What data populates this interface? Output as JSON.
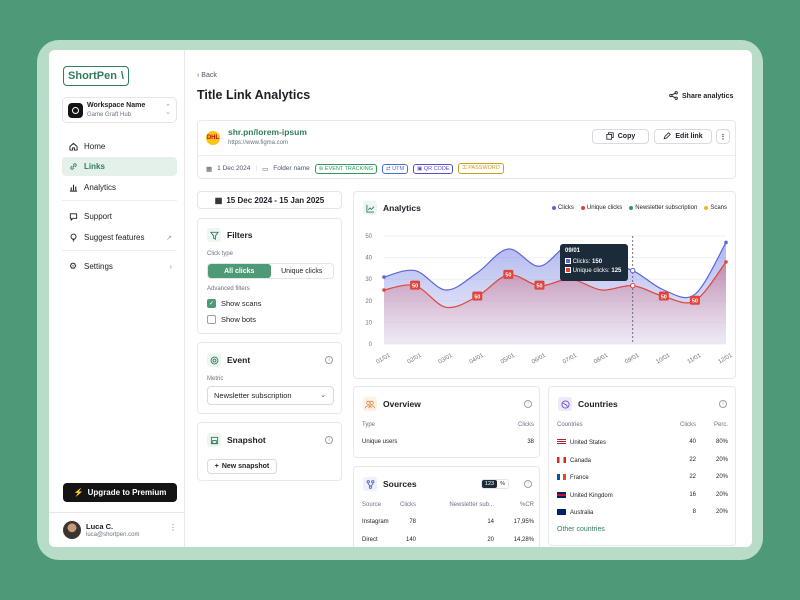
{
  "sidebar": {
    "logo": "ShortPen",
    "workspace": {
      "name": "Workspace Name",
      "sub": "Game Graft Hub"
    },
    "nav": [
      {
        "label": "Home",
        "icon": "home-icon"
      },
      {
        "label": "Links",
        "icon": "link-icon",
        "active": true
      },
      {
        "label": "Analytics",
        "icon": "bar-chart-icon"
      }
    ],
    "nav2": [
      {
        "label": "Support",
        "icon": "chat-icon"
      },
      {
        "label": "Suggest features",
        "icon": "lightbulb-icon"
      }
    ],
    "settings": "Settings",
    "upgrade": "Upgrade to Premium",
    "user": {
      "name": "Luca C.",
      "email": "luca@shortpen.com"
    }
  },
  "header": {
    "back": "Back",
    "title": "Title Link Analytics",
    "share": "Share analytics"
  },
  "link": {
    "short": "shr.pn/lorem-ipsum",
    "dest": "https://www.figma.com",
    "copy": "Copy",
    "edit": "Edit link",
    "date": "1 Dec 2024",
    "folder": "Folder name",
    "tags": [
      {
        "label": "EVENT TRACKING",
        "color": "#2f9a5c"
      },
      {
        "label": "UTM",
        "color": "#4a6fd1"
      },
      {
        "label": "QR CODE",
        "color": "#5a4fc9"
      },
      {
        "label": "PASSWORD",
        "color": "#c9a020"
      }
    ]
  },
  "daterange": "15 Dec 2024 - 15 Jan 2025",
  "filters": {
    "title": "Filters",
    "click_type_label": "Click type",
    "all": "All clicks",
    "unique": "Unique clicks",
    "advanced_label": "Advanced filters",
    "show_scans": "Show scans",
    "show_scans_checked": true,
    "show_bots": "Show bots",
    "show_bots_checked": false
  },
  "event": {
    "title": "Event",
    "metric_label": "Metric",
    "metric_value": "Newsletter subscription"
  },
  "snapshot": {
    "title": "Snapshot",
    "button": "New snapshot"
  },
  "analytics": {
    "title": "Analytics",
    "legend": [
      {
        "label": "Clicks",
        "color": "#5b66d9"
      },
      {
        "label": "Unique clicks",
        "color": "#e0443a"
      },
      {
        "label": "Newsletter subscription",
        "color": "#2f9a5c"
      },
      {
        "label": "Scans",
        "color": "#f0b429"
      }
    ],
    "tooltip": {
      "date": "09/01",
      "clicks_label": "Clicks:",
      "clicks": "150",
      "unique_label": "Unique clicks:",
      "unique": "125"
    }
  },
  "chart_data": {
    "type": "area",
    "x": [
      "01/01",
      "02/01",
      "03/01",
      "04/01",
      "05/01",
      "06/01",
      "07/01",
      "08/01",
      "09/01",
      "10/01",
      "11/01",
      "12/01"
    ],
    "yticks": [
      "0",
      "10",
      "20",
      "30",
      "40",
      "50"
    ],
    "ylim": [
      0,
      50
    ],
    "series": [
      {
        "name": "Clicks",
        "color": "#5b66d9",
        "values": [
          31,
          34,
          25,
          33,
          44,
          36,
          46,
          38,
          34,
          25,
          23,
          47
        ]
      },
      {
        "name": "Unique clicks",
        "color": "#e0443a",
        "values": [
          25,
          27,
          17,
          22,
          32,
          27,
          30,
          25,
          27,
          22,
          20,
          38
        ]
      }
    ],
    "markers": [
      {
        "x": "02/01",
        "label": "50"
      },
      {
        "x": "04/01",
        "label": "50"
      },
      {
        "x": "05/01",
        "label": "50"
      },
      {
        "x": "06/01",
        "label": "50"
      },
      {
        "x": "10/01",
        "label": "50"
      },
      {
        "x": "11/01",
        "label": "50"
      }
    ],
    "highlight": "09/01"
  },
  "overview": {
    "title": "Overview",
    "col1": "Type",
    "col2": "Clicks",
    "rows": [
      {
        "type": "Unique users",
        "clicks": "38"
      }
    ]
  },
  "sources": {
    "title": "Sources",
    "toggle": [
      "123",
      "%"
    ],
    "cols": [
      "Source",
      "Clicks",
      "Newsletter sub...",
      "%CR"
    ],
    "rows": [
      {
        "source": "Instagram",
        "clicks": "78",
        "nl": "14",
        "cr": "17,95%"
      },
      {
        "source": "Direct",
        "clicks": "140",
        "nl": "20",
        "cr": "14,28%"
      }
    ]
  },
  "countries": {
    "title": "Countries",
    "cols": [
      "Countries",
      "Clicks",
      "Perc."
    ],
    "rows": [
      {
        "name": "United States",
        "clicks": "40",
        "perc": "80%",
        "flag": "us"
      },
      {
        "name": "Canada",
        "clicks": "22",
        "perc": "20%",
        "flag": "ca"
      },
      {
        "name": "France",
        "clicks": "22",
        "perc": "20%",
        "flag": "fr"
      },
      {
        "name": "United Kingdom",
        "clicks": "16",
        "perc": "20%",
        "flag": "uk"
      },
      {
        "name": "Australia",
        "clicks": "8",
        "perc": "20%",
        "flag": "au"
      }
    ],
    "other": "Other countries"
  }
}
